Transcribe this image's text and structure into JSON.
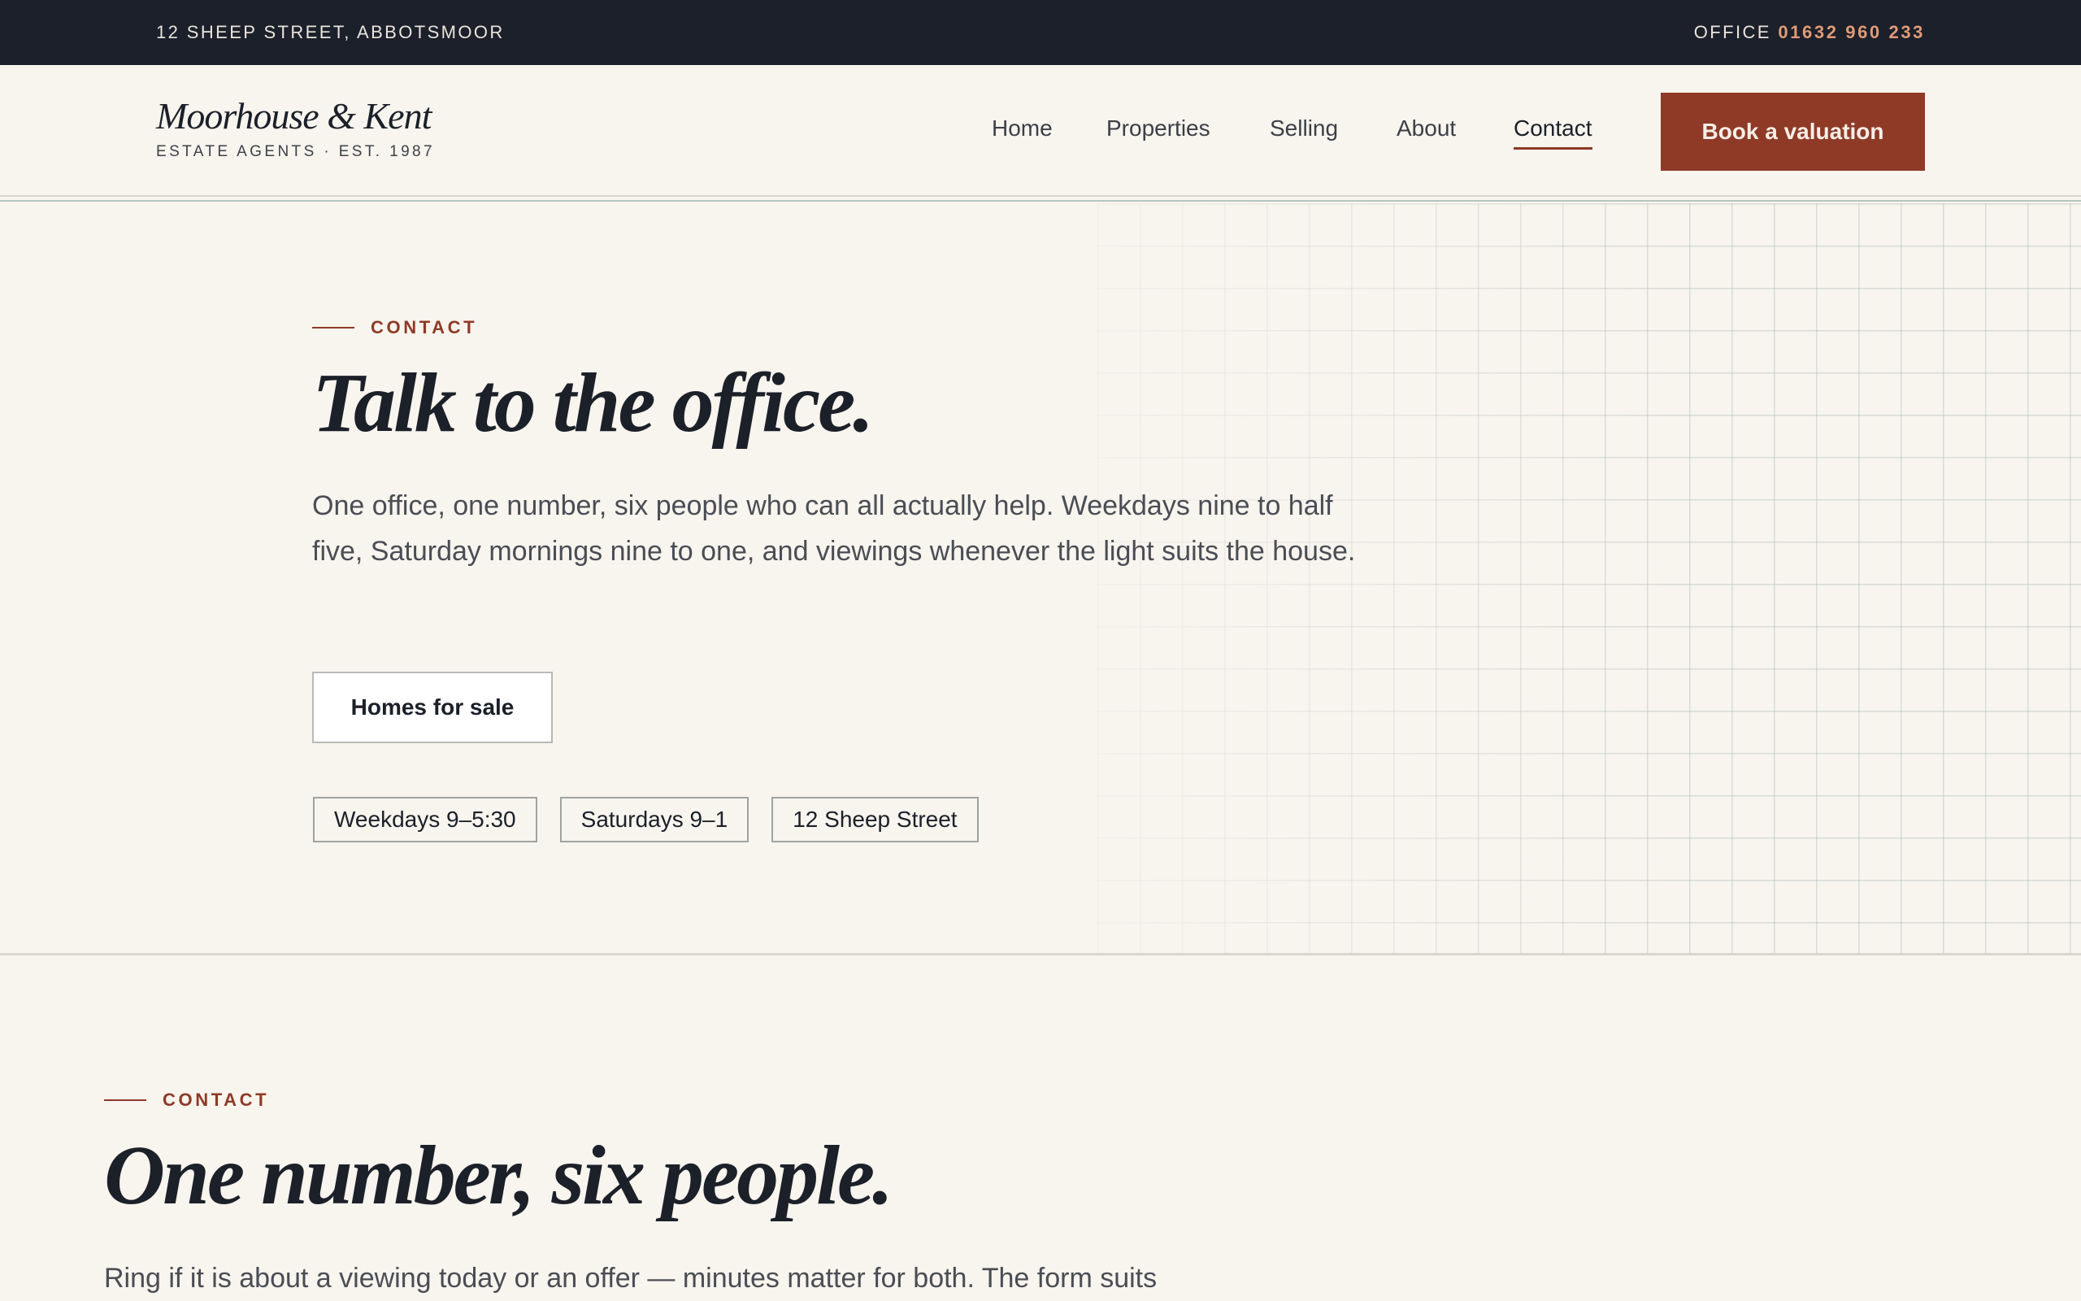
{
  "topbar": {
    "address": "12 SHEEP STREET, ABBOTSMOOR",
    "office_label": "OFFICE ",
    "office_phone": "01632 960 233"
  },
  "brand": {
    "name": "Moorhouse & Kent",
    "tagline": "ESTATE AGENTS · EST. 1987"
  },
  "nav": {
    "items": [
      "Home",
      "Properties",
      "Selling",
      "About",
      "Contact"
    ],
    "active": "Contact",
    "cta_label": "Book a valuation"
  },
  "hero": {
    "eyebrow": "CONTACT",
    "title": "Talk to the office.",
    "lede": "One office, one number, six people who can all actually help. Weekdays nine to half five, Saturday mornings nine to one, and viewings whenever the light suits the house.",
    "button_label": "Homes for sale",
    "chips": [
      "Weekdays 9–5:30",
      "Saturdays 9–1",
      "12 Sheep Street"
    ]
  },
  "section2": {
    "eyebrow": "CONTACT",
    "title": "One number, six people.",
    "lede": "Ring if it is about a viewing today or an offer — minutes matter for both. The form suits"
  },
  "colors": {
    "accent": "#8e3a27",
    "topbar_bg": "#1b202a",
    "phone": "#e09a78",
    "page_bg": "#f8f4ee"
  }
}
